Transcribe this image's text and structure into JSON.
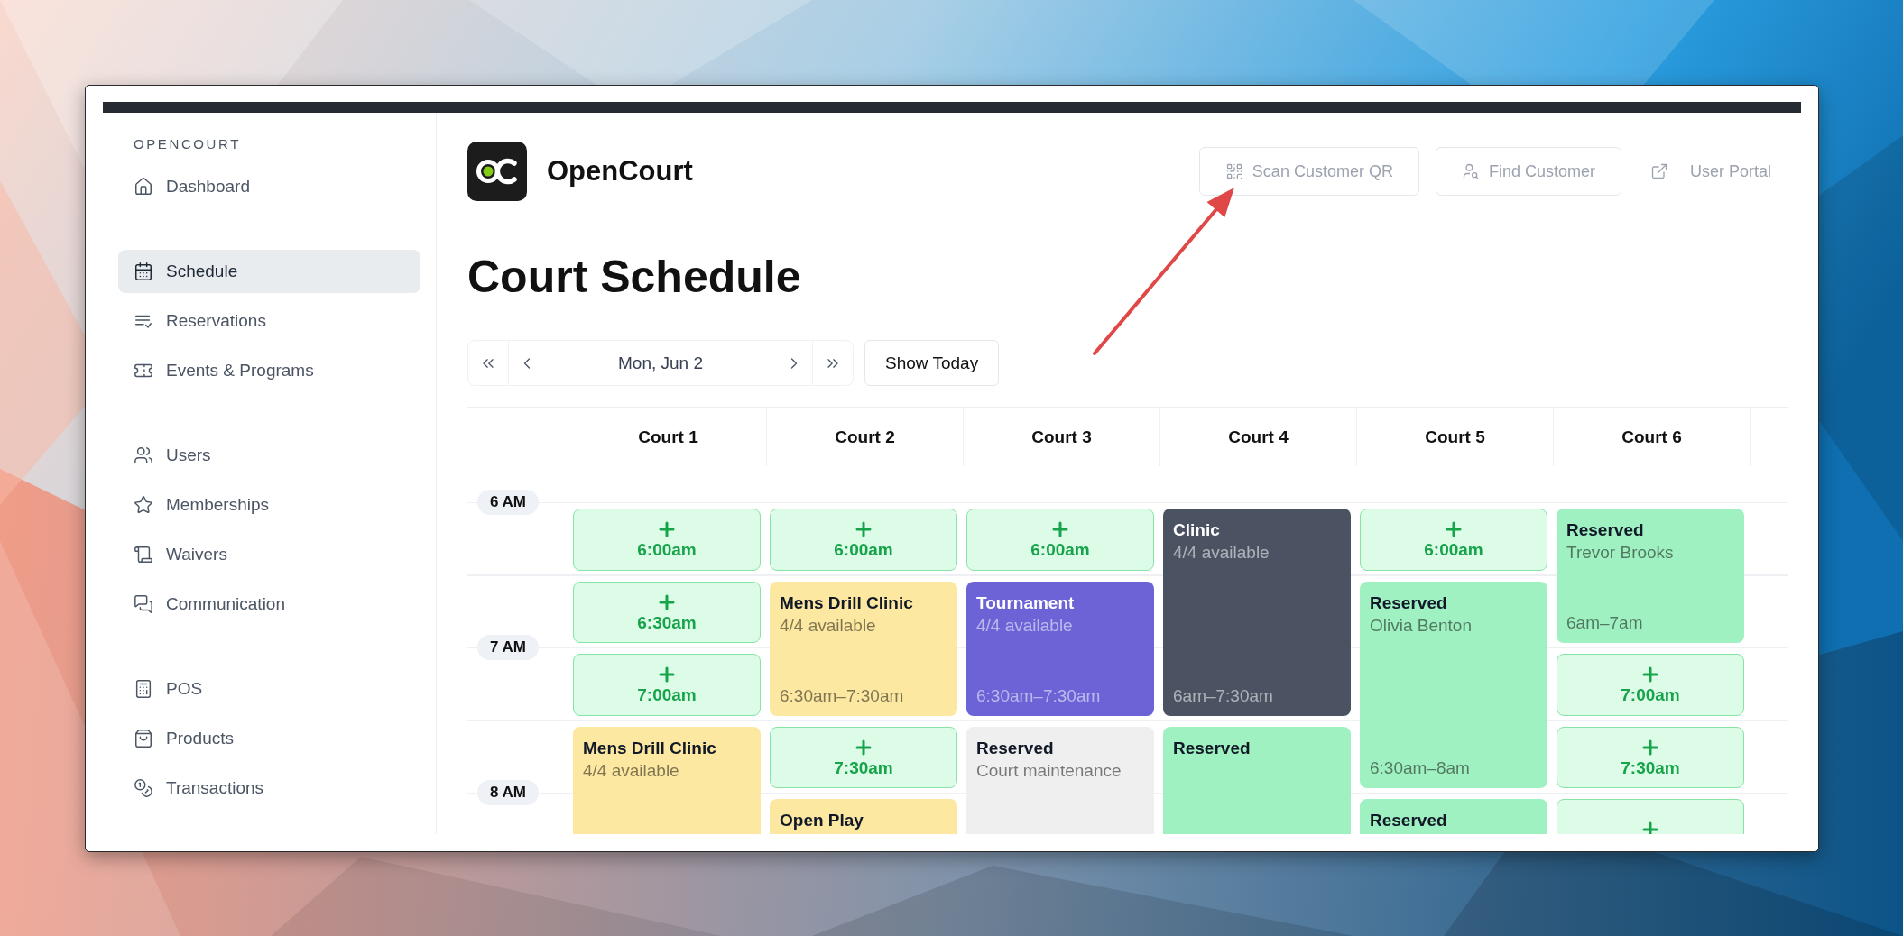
{
  "sidebar": {
    "brand": "OPENCOURT",
    "groups": [
      [
        {
          "label": "Dashboard",
          "selected": false
        }
      ],
      [
        {
          "label": "Schedule",
          "selected": true
        },
        {
          "label": "Reservations",
          "selected": false
        },
        {
          "label": "Events & Programs",
          "selected": false
        }
      ],
      [
        {
          "label": "Users",
          "selected": false
        },
        {
          "label": "Memberships",
          "selected": false
        },
        {
          "label": "Waivers",
          "selected": false
        },
        {
          "label": "Communication",
          "selected": false
        }
      ],
      [
        {
          "label": "POS",
          "selected": false
        },
        {
          "label": "Products",
          "selected": false
        },
        {
          "label": "Transactions",
          "selected": false
        }
      ]
    ]
  },
  "header": {
    "app_name": "OpenCourt",
    "actions": [
      {
        "label": "Scan Customer QR",
        "kind": "outlined"
      },
      {
        "label": "Find Customer",
        "kind": "outlined"
      },
      {
        "label": "User Portal",
        "kind": "link"
      }
    ]
  },
  "page_title": "Court Schedule",
  "date_nav": {
    "date": "Mon, Jun 2",
    "today_button": "Show Today"
  },
  "schedule": {
    "times": [
      "6 AM",
      "7 AM",
      "8 AM"
    ],
    "courts": [
      {
        "name": "Court 1",
        "slots": [
          {
            "kind": "open",
            "time": "6:00am"
          },
          {
            "kind": "open",
            "time": "6:30am"
          },
          {
            "kind": "open",
            "time": "7:00am"
          },
          {
            "kind": "booking",
            "title": "Mens Drill Clinic",
            "detail": "4/4 available",
            "color": "#fce8a0"
          }
        ]
      },
      {
        "name": "Court 2",
        "slots": [
          {
            "kind": "open",
            "time": "6:00am"
          },
          {
            "kind": "booking",
            "title": "Mens Drill Clinic",
            "detail": "4/4 available",
            "time": "6:30am–7:30am",
            "color": "#fce8a0"
          },
          {
            "kind": "open",
            "time": "7:30am"
          },
          {
            "kind": "booking",
            "title": "Open Play",
            "color": "#fce8a0"
          }
        ]
      },
      {
        "name": "Court 3",
        "slots": [
          {
            "kind": "open",
            "time": "6:00am"
          },
          {
            "kind": "booking",
            "title": "Tournament",
            "detail": "4/4 available",
            "time": "6:30am–7:30am",
            "color": "#6b63d6"
          },
          {
            "kind": "booking",
            "title": "Reserved",
            "detail": "Court maintenance",
            "color": "#efefef"
          }
        ]
      },
      {
        "name": "Court 4",
        "slots": [
          {
            "kind": "booking",
            "title": "Clinic",
            "detail": "4/4 available",
            "time": "6am–7:30am",
            "color": "#4b5262"
          },
          {
            "kind": "booking",
            "title": "Reserved",
            "color": "#a0f1c1"
          }
        ]
      },
      {
        "name": "Court 5",
        "slots": [
          {
            "kind": "open",
            "time": "6:00am"
          },
          {
            "kind": "booking",
            "title": "Reserved",
            "detail": "Olivia Benton",
            "time": "6:30am–8am",
            "color": "#a0f1c1"
          },
          {
            "kind": "booking",
            "title": "Reserved",
            "color": "#a0f1c1"
          }
        ]
      },
      {
        "name": "Court 6",
        "slots": [
          {
            "kind": "booking",
            "title": "Reserved",
            "detail": "Trevor Brooks",
            "time": "6am–7am",
            "color": "#a0f1c1"
          },
          {
            "kind": "open",
            "time": "7:00am"
          },
          {
            "kind": "open",
            "time": "7:30am"
          },
          {
            "kind": "open"
          }
        ]
      }
    ]
  }
}
